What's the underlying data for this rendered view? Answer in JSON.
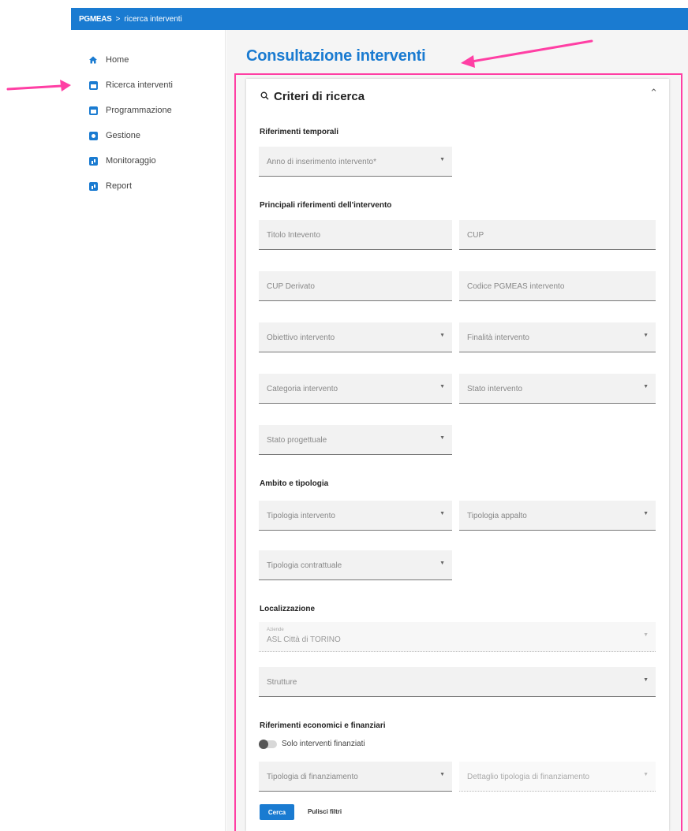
{
  "breadcrumb": {
    "app": "PGMEAS",
    "separator": ">",
    "page": "ricerca interventi"
  },
  "sidebar": {
    "items": [
      {
        "label": "Home",
        "icon": "home-icon"
      },
      {
        "label": "Ricerca interventi",
        "icon": "calendar-icon"
      },
      {
        "label": "Programmazione",
        "icon": "calendar-icon"
      },
      {
        "label": "Gestione",
        "icon": "gear-icon"
      },
      {
        "label": "Monitoraggio",
        "icon": "chart-icon"
      },
      {
        "label": "Report",
        "icon": "chart-icon"
      }
    ]
  },
  "main": {
    "title": "Consultazione interventi",
    "card_title": "Criteri di ricerca",
    "sections": {
      "temporali": "Riferimenti temporali",
      "principali": "Principali riferimenti dell'intervento",
      "ambito": "Ambito e tipologia",
      "localizzazione": "Localizzazione",
      "economici": "Riferimenti economici e finanziari"
    },
    "fields": {
      "anno": "Anno di inserimento intervento*",
      "titolo": "Titolo Intevento",
      "cup": "CUP",
      "cup_derivato": "CUP Derivato",
      "codice": "Codice PGMEAS intervento",
      "obiettivo": "Obiettivo intervento",
      "finalita": "Finalità intervento",
      "categoria": "Categoria intervento",
      "stato": "Stato intervento",
      "stato_progettuale": "Stato progettuale",
      "tipologia_intervento": "Tipologia intervento",
      "tipologia_appalto": "Tipologia appalto",
      "tipologia_contrattuale": "Tipologia contrattuale",
      "aziende_label": "Aziende",
      "aziende_value": "ASL Città di TORINO",
      "strutture": "Strutture",
      "tipologia_finanziamento": "Tipologia di finanziamento",
      "dettaglio_finanziamento": "Dettaglio tipologia di finanziamento"
    },
    "toggle_label": "Solo interventi finanziati",
    "buttons": {
      "search": "Cerca",
      "clear": "Pulisci filtri"
    }
  },
  "colors": {
    "accent": "#1a7bd1",
    "highlight": "#ff3fa4"
  }
}
